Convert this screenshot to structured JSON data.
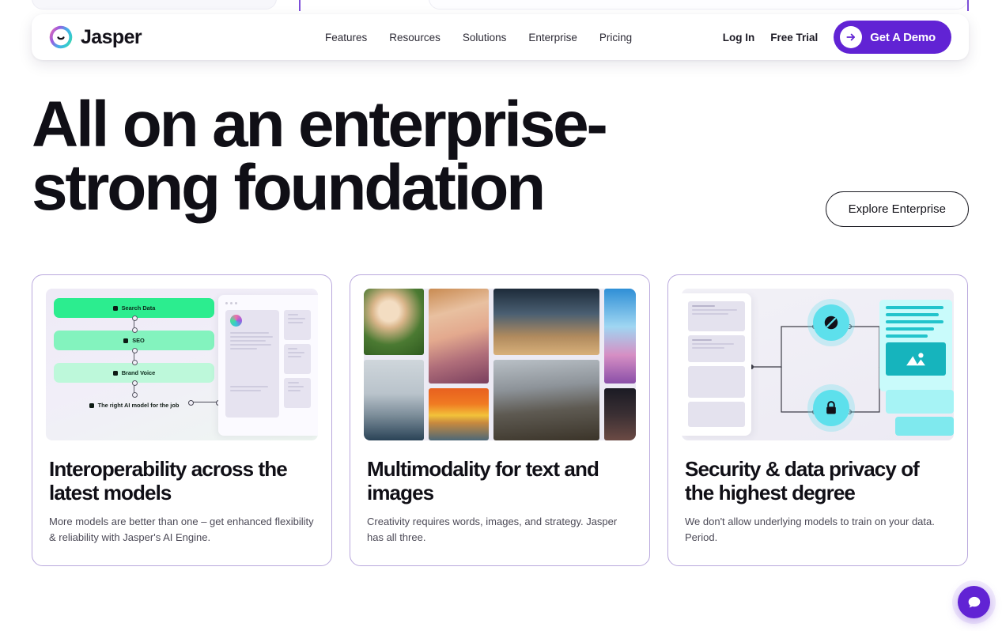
{
  "brand": {
    "name": "Jasper",
    "logo_icon": "jasper-logo-icon"
  },
  "nav": {
    "links": [
      {
        "label": "Features"
      },
      {
        "label": "Resources"
      },
      {
        "label": "Solutions"
      },
      {
        "label": "Enterprise"
      },
      {
        "label": "Pricing"
      }
    ],
    "login_label": "Log In",
    "free_trial_label": "Free Trial",
    "demo_label": "Get A Demo",
    "demo_icon": "arrow-right-icon",
    "demo_color": "#6123d4"
  },
  "hero": {
    "title": "All on an enterprise-strong foundation",
    "cta_label": "Explore Enterprise"
  },
  "cards": [
    {
      "title": "Interoperability across the latest models",
      "body": "More models are better than one – get enhanced flexibility & reliability with Jasper's AI Engine.",
      "art": {
        "type": "flow-pills",
        "pills": [
          {
            "label": "Search Data",
            "color": "#2ced8f"
          },
          {
            "label": "SEO",
            "color": "#83f3be"
          },
          {
            "label": "Brand Voice",
            "color": "#bdf8da"
          },
          {
            "label": "The right AI model for the job",
            "color": "transparent"
          }
        ]
      }
    },
    {
      "title": "Multimodality for text and images",
      "body": "Creativity requires words, images, and strategy. Jasper has all three.",
      "art": {
        "type": "image-mosaic",
        "tiles": [
          "dog-photo",
          "sailing-ship-photo",
          "portrait-photo",
          "sunset-ocean-photo",
          "silhouettes-photo",
          "stormy-landscape-photo",
          "blue-abstract-photo",
          "dark-abstract-photo"
        ]
      }
    },
    {
      "title": "Security & data privacy of the highest degree",
      "body": "We don't allow underlying models to train on your data. Period.",
      "art": {
        "type": "security-flow",
        "nodes": [
          {
            "icon": "blocked-icon"
          },
          {
            "icon": "lock-icon"
          }
        ],
        "accent": "#5de0ec"
      }
    }
  ],
  "chat": {
    "icon": "chat-bubble-icon",
    "color": "#6123d4"
  },
  "theme": {
    "page_bg": "#ffffff",
    "card_border": "#b9a8dd",
    "text": "#100f16"
  }
}
